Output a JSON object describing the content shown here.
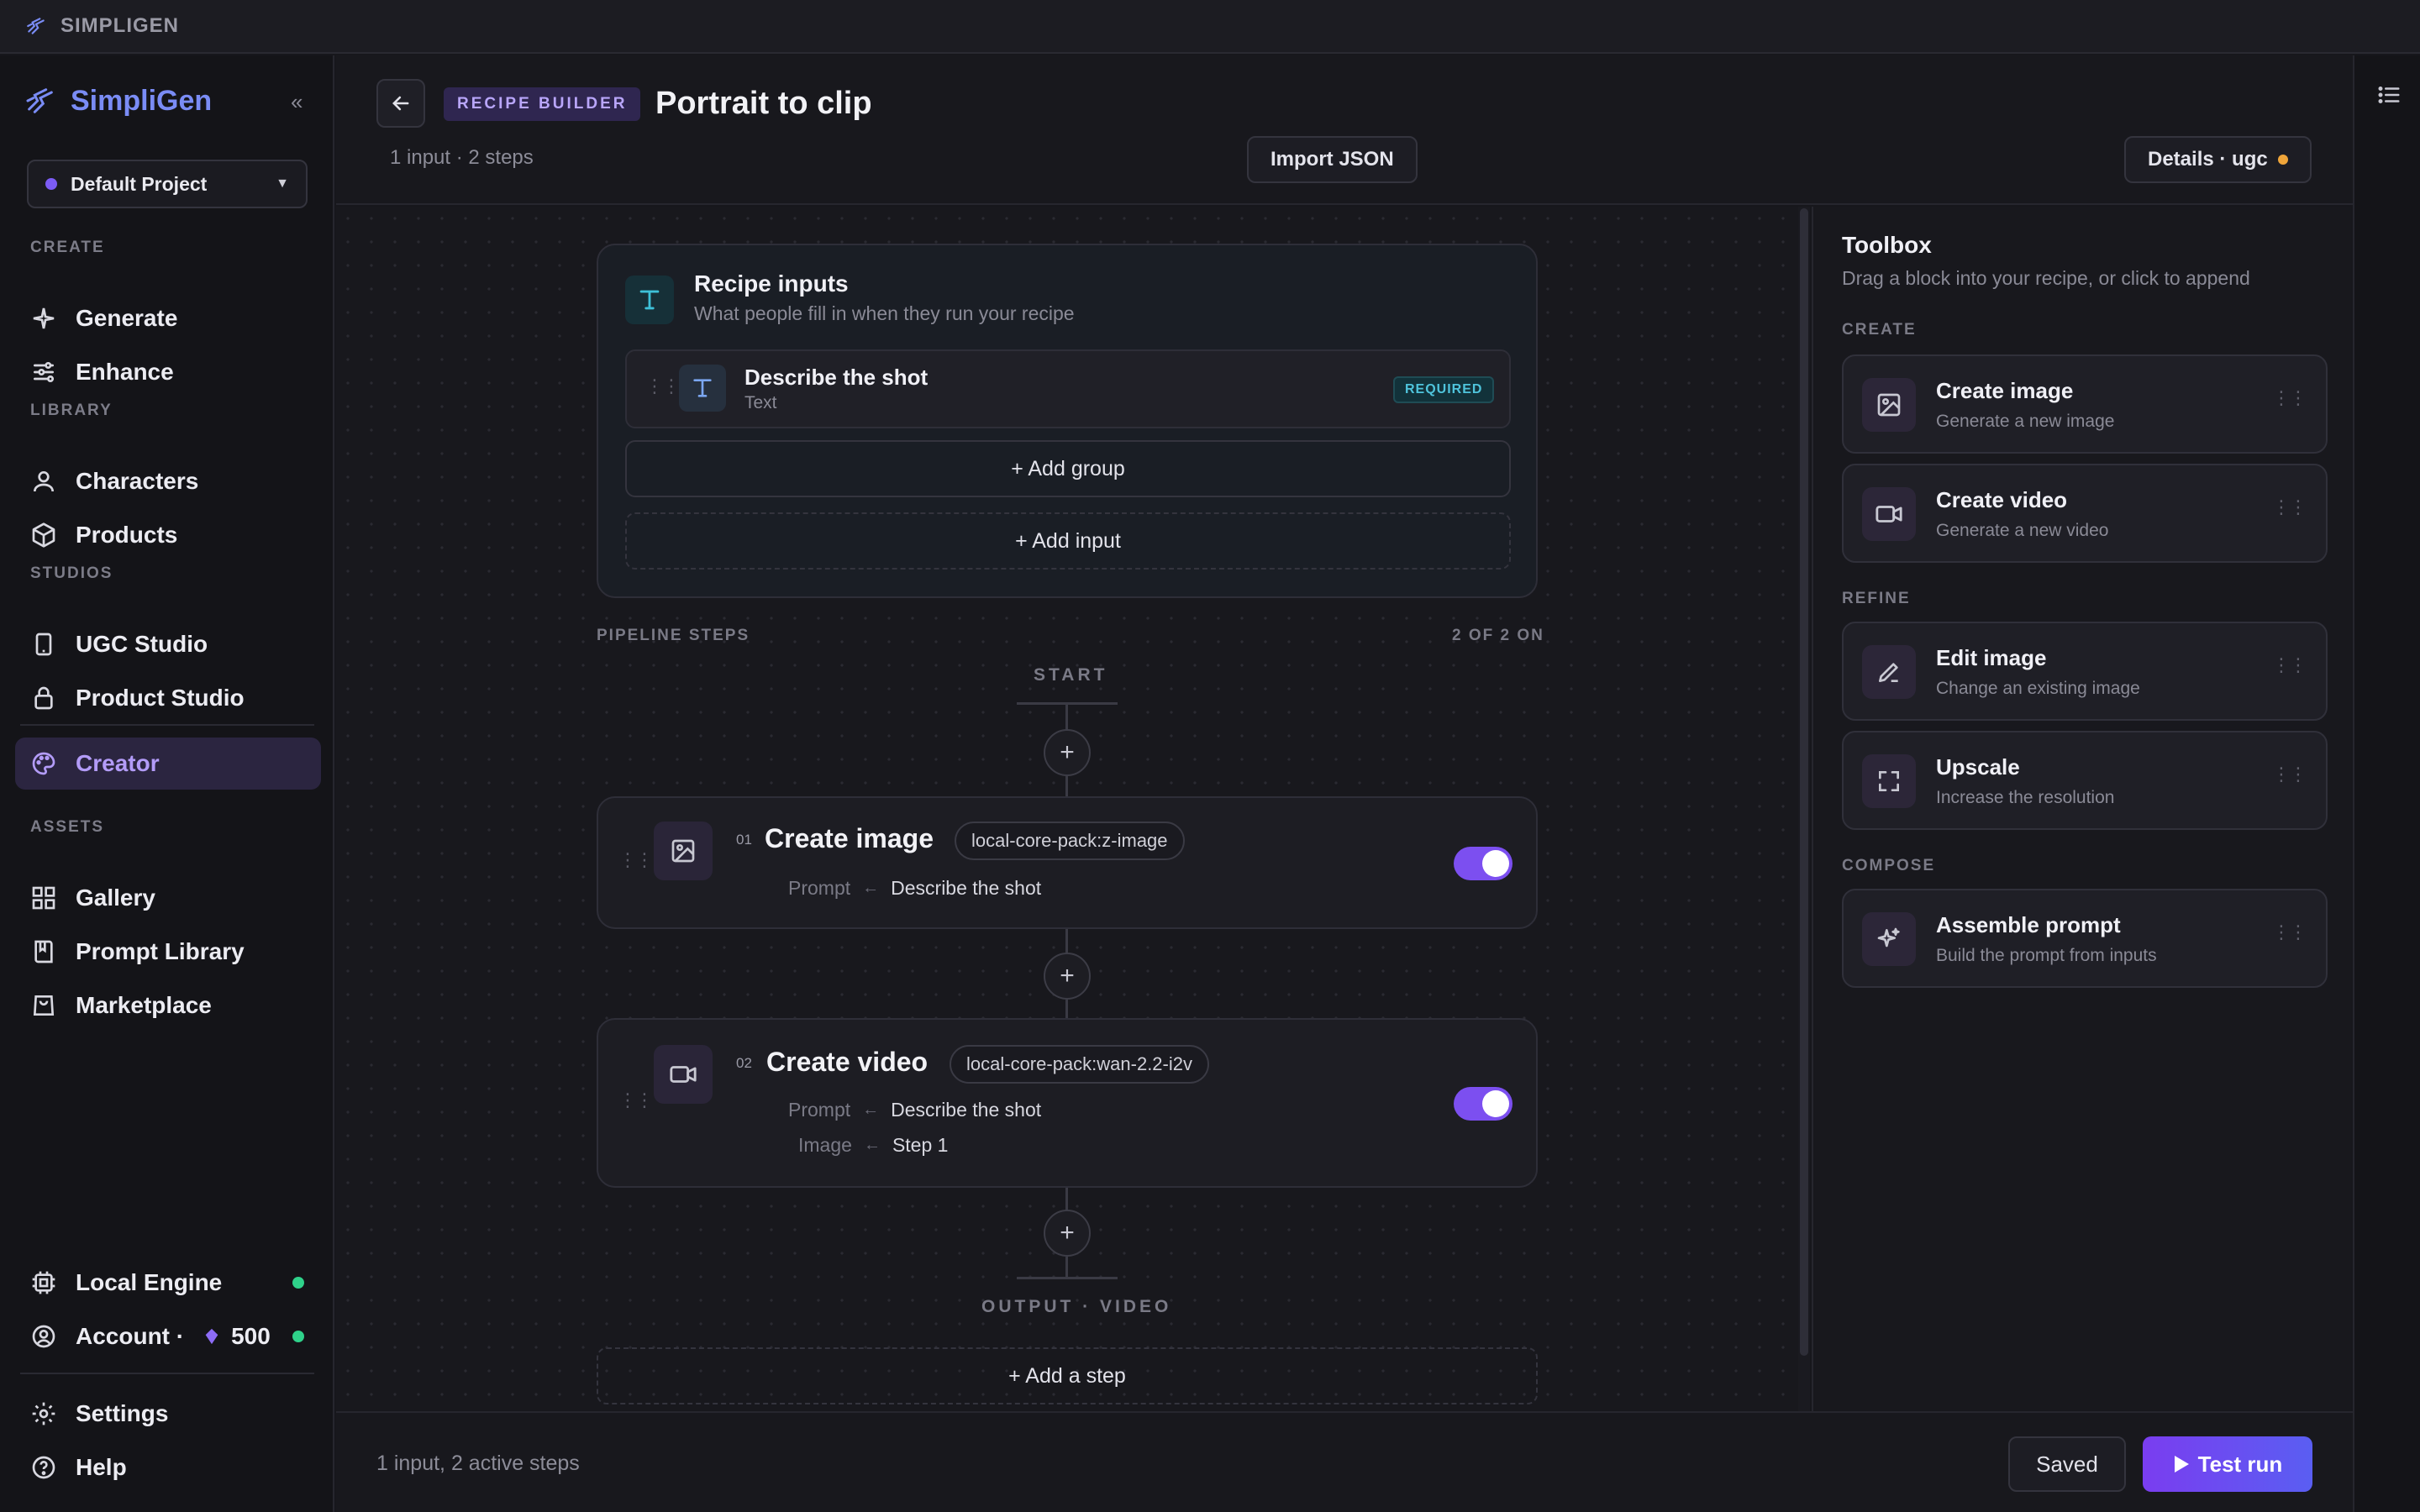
{
  "app": {
    "window_title": "SIMPLIGEN",
    "brand": "SimpliGen"
  },
  "sidebar": {
    "project": "Default Project",
    "sections": {
      "create": "CREATE",
      "library": "LIBRARY",
      "studios": "STUDIOS",
      "assets": "ASSETS"
    },
    "items": {
      "generate": "Generate",
      "enhance": "Enhance",
      "characters": "Characters",
      "products": "Products",
      "ugc_studio": "UGC Studio",
      "product_studio": "Product Studio",
      "creator": "Creator",
      "gallery": "Gallery",
      "prompt_library": "Prompt Library",
      "marketplace": "Marketplace",
      "local_engine": "Local Engine",
      "account": "Account ·",
      "account_credits": "500",
      "settings": "Settings",
      "help": "Help"
    }
  },
  "header": {
    "badge": "RECIPE BUILDER",
    "title": "Portrait to clip",
    "subtitle": "1 input · 2 steps",
    "import_label": "Import JSON",
    "details_label": "Details · ugc"
  },
  "recipe_inputs": {
    "title": "Recipe inputs",
    "subtitle": "What people fill in when they run your recipe",
    "input": {
      "name": "Describe the shot",
      "type": "Text",
      "badge": "REQUIRED"
    },
    "add_group": "+ Add group",
    "add_input": "+ Add input"
  },
  "pipeline": {
    "label": "PIPELINE STEPS",
    "count": "2 OF 2 ON",
    "start": "START",
    "output": "OUTPUT · VIDEO",
    "add_step": "+ Add a step",
    "steps": [
      {
        "num": "01",
        "title": "Create image",
        "model": "local-core-pack:z-image",
        "mappings": [
          {
            "key": "Prompt",
            "value": "Describe the shot"
          }
        ],
        "enabled": true
      },
      {
        "num": "02",
        "title": "Create video",
        "model": "local-core-pack:wan-2.2-i2v",
        "mappings": [
          {
            "key": "Prompt",
            "value": "Describe the shot"
          },
          {
            "key": "Image",
            "value": "Step 1"
          }
        ],
        "enabled": true
      }
    ]
  },
  "toolbox": {
    "title": "Toolbox",
    "subtitle": "Drag a block into your recipe, or click to append",
    "sections": {
      "create": "CREATE",
      "refine": "REFINE",
      "compose": "COMPOSE"
    },
    "tools": {
      "create_image": {
        "name": "Create image",
        "desc": "Generate a new image"
      },
      "create_video": {
        "name": "Create video",
        "desc": "Generate a new video"
      },
      "edit_image": {
        "name": "Edit image",
        "desc": "Change an existing image"
      },
      "upscale": {
        "name": "Upscale",
        "desc": "Increase the resolution"
      },
      "assemble_prompt": {
        "name": "Assemble prompt",
        "desc": "Build the prompt from inputs"
      }
    }
  },
  "footer": {
    "summary": "1 input, 2 active steps",
    "saved": "Saved",
    "test_run": "Test run"
  },
  "colors": {
    "accent": "#7c4ff0",
    "brand": "#7a8cf5",
    "status_ok": "#2fd28a",
    "status_warn": "#f0a53a"
  }
}
